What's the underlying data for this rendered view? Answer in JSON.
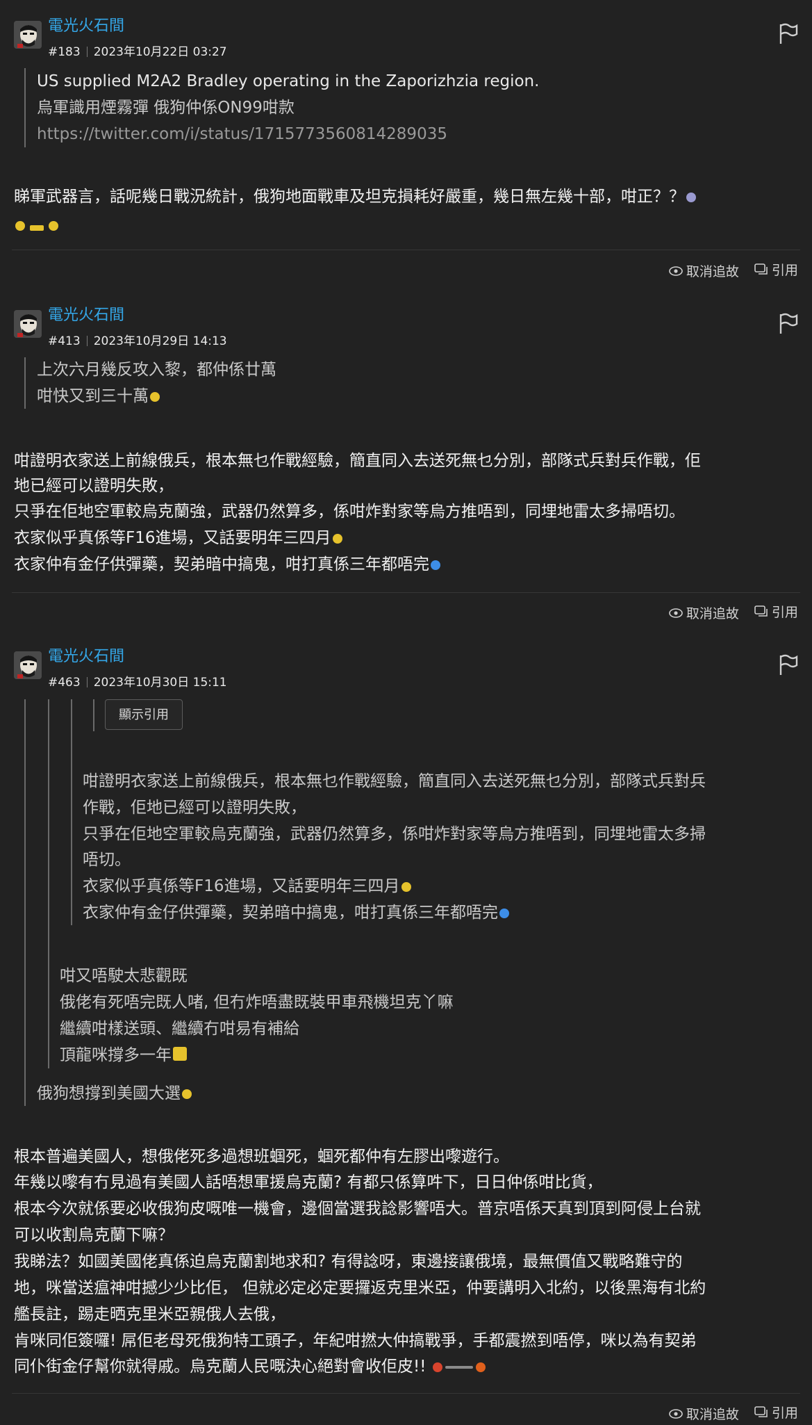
{
  "posts": [
    {
      "username": "電光火石間",
      "number": "#183",
      "date": "2023年10月22日 03:27",
      "quote": [
        "US supplied M2A2 Bradley operating in the Zaporizhzia region.",
        "烏軍識用煙霧彈 俄狗仲係ON99咁款",
        "https://twitter.com/i/status/1715773560814289035"
      ],
      "body": [
        "睇軍武器言，話呢幾日戰況統計，俄狗地面戰車及坦克損耗好嚴重，幾日無左幾十部，咁正？？"
      ],
      "actions": {
        "unfollow": "取消追故",
        "quote": "引用"
      }
    },
    {
      "username": "電光火石間",
      "number": "#413",
      "date": "2023年10月29日 14:13",
      "quote": [
        "上次六月幾反攻入黎，都仲係廿萬",
        "咁快又到三十萬"
      ],
      "body": [
        "咁證明衣家送上前線俄兵，根本無乜作戰經驗，簡直同入去送死無乜分別，部隊式兵對兵作戰，佢",
        "地已經可以證明失敗，",
        "只爭在佢地空軍較烏克蘭強，武器仍然算多，係咁炸對家等烏方推唔到，同埋地雷太多掃唔切。",
        "衣家似乎真係等F16進場，又話要明年三四月",
        "衣家仲有金仔供彈藥，契弟暗中搞鬼，咁打真係三年都唔完"
      ],
      "actions": {
        "unfollow": "取消追故",
        "quote": "引用"
      }
    },
    {
      "username": "電光火石間",
      "number": "#463",
      "date": "2023年10月30日 15:11",
      "show_quote": "顯示引用",
      "nested_quote": [
        "咁證明衣家送上前線俄兵，根本無乜作戰經驗，簡直同入去送死無乜分別，部隊式兵對兵",
        "作戰，佢地已經可以證明失敗，",
        "只爭在佢地空軍較烏克蘭強，武器仍然算多，係咁炸對家等烏方推唔到，同埋地雷太多掃",
        "唔切。",
        "衣家似乎真係等F16進場，又話要明年三四月",
        "衣家仲有金仔供彈藥，契弟暗中搞鬼，咁打真係三年都唔完"
      ],
      "mid_quote": [
        "咁又唔駛太悲觀既",
        "俄佬有死唔完既人啫, 但冇炸唔盡既裝甲車飛機坦克丫嘛",
        "繼續咁樣送頭、繼續冇咁易有補給",
        "頂龍咪撐多一年"
      ],
      "outer_quote": [
        "俄狗想撐到美國大選"
      ],
      "body": [
        "根本普遍美國人，想俄佬死多過想班蝈死，蝈死都仲有左膠出嚟遊行。",
        "年幾以嚟有冇見過有美國人話唔想軍援烏克蘭? 有都只係算吽下，日日仲係咁比貨，",
        "根本今次就係要必收俄狗皮嘅唯一機會，邊個當選我諗影響唔大。普京唔係天真到頂到阿侵上台就",
        "可以收割烏克蘭下嘛？",
        "我睇法？如國美國佬真係迫烏克蘭割地求和? 有得諗呀，東邊接讓俄境，最無價值又戰略難守的",
        "地，咪當送瘟神咁撼少少比佢， 但就必定必定要攞返克里米亞，仲要講明入北約，以後黑海有北約",
        "艦長註，踢走晒克里米亞親俄人去俄，",
        "肯咪同佢簽囉! 屌佢老母死俄狗特工頭子，年紀咁撚大仲搞戰爭，手都震撚到唔停，咪以為有契弟",
        "同仆街金仔幫你就得戚。烏克蘭人民嘅決心絕對會收佢皮!!"
      ],
      "actions": {
        "unfollow": "取消追故",
        "quote": "引用"
      }
    }
  ]
}
